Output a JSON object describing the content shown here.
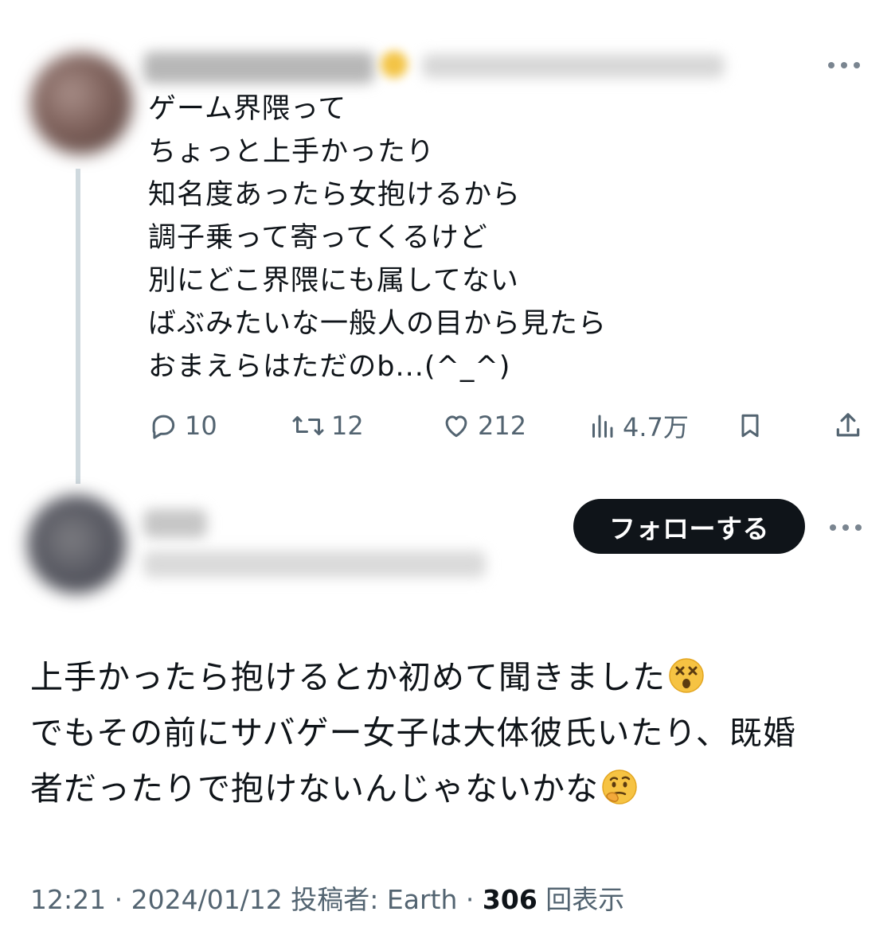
{
  "parent_tweet": {
    "lines": [
      "ゲーム界隈って",
      "ちょっと上手かったり",
      "知名度あったら女抱けるから",
      "調子乗って寄ってくるけど",
      "別にどこ界隈にも属してない",
      "ばぶみたいな一般人の目から見たら",
      "おまえらはただのb...(^_^)"
    ],
    "actions": {
      "replies": "10",
      "retweets": "12",
      "likes": "212",
      "views": "4.7万"
    },
    "icons": {
      "more": "more-horizontal-icon",
      "reply": "reply-bubble-icon",
      "retweet": "retweet-icon",
      "like": "heart-icon",
      "views": "views-bar-chart-icon",
      "bookmark": "bookmark-icon",
      "share": "share-icon"
    }
  },
  "reply_author": {
    "follow_label": "フォローする",
    "more_icon": "more-horizontal-icon"
  },
  "reply_tweet": {
    "line1": "上手かったら抱けるとか初めて聞きました",
    "line1_emoji": "dizzy-face-emoji",
    "line2": "でもその前にサバゲー女子は大体彼氏いたり、既婚",
    "line3": "者だったりで抱けないんじゃないかな",
    "line3_emoji": "thinking-face-emoji"
  },
  "meta": {
    "time": "12:21",
    "separator": " · ",
    "date": "2024/01/12",
    "posted_by_label": "投稿者: Earth",
    "view_count": "306",
    "views_label": "回表示"
  },
  "colors": {
    "text": "#0f1419",
    "secondary": "#536471",
    "thread_line": "#cfd9de",
    "button_bg": "#0f1419"
  }
}
